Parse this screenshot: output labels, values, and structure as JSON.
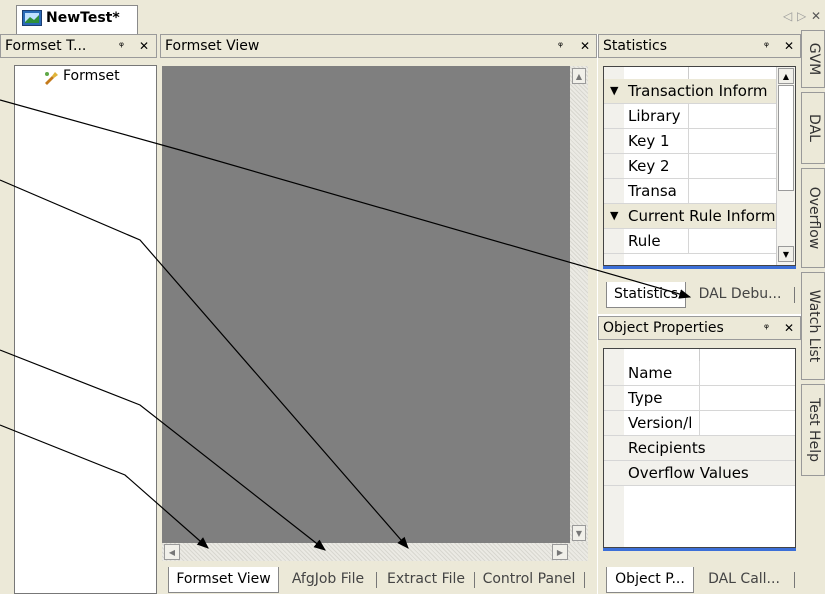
{
  "document_tab": {
    "title": "NewTest*",
    "icon": "form-icon"
  },
  "doc_bar_controls": {
    "prev": "◁",
    "next": "▷",
    "close": "✕"
  },
  "panel_buttons": {
    "pin": "ᵠ",
    "close": "✕"
  },
  "formset_tree": {
    "title": "Formset T...",
    "root": {
      "label": "Formset",
      "icon": "formset-icon"
    }
  },
  "formset_view": {
    "title": "Formset View"
  },
  "bottom_tabs": [
    "Formset View",
    "AfgJob File",
    "Extract File",
    "Control Panel"
  ],
  "statistics": {
    "title": "Statistics",
    "rows": [
      {
        "label": "Transaction Inform",
        "category": true
      },
      {
        "label": "Library"
      },
      {
        "label": "Key 1"
      },
      {
        "label": "Key 2"
      },
      {
        "label": "Transa"
      },
      {
        "label": "Current Rule Inform",
        "category": true
      },
      {
        "label": "Rule"
      }
    ],
    "tabs": [
      "Statistics",
      "DAL Debu..."
    ]
  },
  "object_properties": {
    "title": "Object Properties",
    "rows": [
      "Name",
      "Type",
      "Version/l",
      "Recipients",
      "Overflow Values"
    ],
    "tabs": [
      "Object P...",
      "DAL Call..."
    ]
  },
  "side_tabs": [
    "GVM",
    "DAL",
    "Overflow",
    "Watch List",
    "Test Help"
  ]
}
